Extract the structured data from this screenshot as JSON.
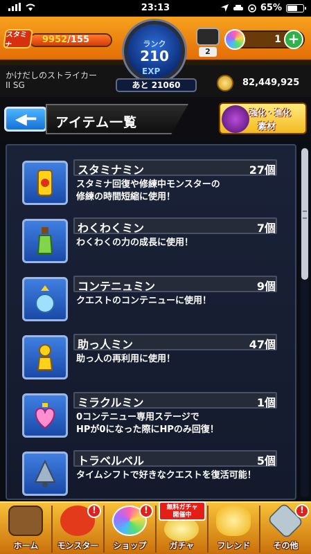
{
  "status_bar": {
    "time": "23:13",
    "battery": "65%",
    "battery_level": 0.65
  },
  "header": {
    "stamina_label": "スタミナ",
    "stamina_current": "9952",
    "stamina_max": "/155",
    "rank_label": "ランク",
    "rank_value": "210",
    "exp_label": "EXP",
    "exp_remaining": "あと 21060",
    "orb_slot_count": "2",
    "orb_count": "1",
    "player_name": "かけだしのストライカー",
    "player_sub": "II SG",
    "gold": "82,449,925"
  },
  "title_bar": {
    "title": "アイテム一覧",
    "evolve_line1": "強化・進化",
    "evolve_line2": "素材"
  },
  "items": [
    {
      "name": "スタミナミン",
      "count": "27個",
      "desc1": "スタミナ回復や修練中モンスターの",
      "desc2": "修練の時間短縮に使用！",
      "icon": "can-icon"
    },
    {
      "name": "わくわくミン",
      "count": "7個",
      "desc1": "わくわくの力の成長に使用！",
      "desc2": "",
      "icon": "bottle-icon"
    },
    {
      "name": "コンテニュミン",
      "count": "9個",
      "desc1": "クエストのコンテニューに使用！",
      "desc2": "",
      "icon": "potion-icon"
    },
    {
      "name": "助っ人ミン",
      "count": "47個",
      "desc1": "助っ人の再利用に使用！",
      "desc2": "",
      "icon": "figure-icon"
    },
    {
      "name": "ミラクルミン",
      "count": "1個",
      "desc1": "0コンテニュー専用ステージで",
      "desc2": "HPが0になった際にHPのみ回復！",
      "icon": "heart-icon"
    },
    {
      "name": "トラベルベル",
      "count": "5個",
      "desc1": "タイムシフトで好きなクエストを復活可能！",
      "desc2": "",
      "icon": "bell-icon"
    }
  ],
  "bottom_nav": [
    {
      "label": "ホーム"
    },
    {
      "label": "モンスター"
    },
    {
      "label": "ショップ"
    },
    {
      "label": "ガチャ",
      "tag_line1": "無料ガチャ",
      "tag_line2": "開催中"
    },
    {
      "label": "フレンド"
    },
    {
      "label": "その他"
    }
  ],
  "colors": {
    "accent_orange": "#f6a21e",
    "panel": "#1a2238",
    "alert": "#e0201a",
    "back_blue": "#1570d6"
  }
}
